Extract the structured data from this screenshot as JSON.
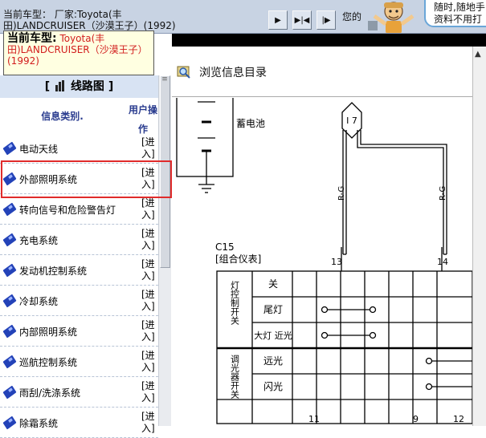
{
  "topbar": {
    "current_model_line": "当前车型：  厂家:Toyota(丰田)LANDCRUISER（沙漠王子）(1992)",
    "help_caption": "您的",
    "bubble_text": "随时,随地手 资料不用打"
  },
  "nav": {
    "forward": "▶",
    "skip": "▶|◀",
    "end": "|▶"
  },
  "model_box": {
    "label": "当前车型:",
    "value": "Toyota(丰田)LANDCRUISER（沙漠王子）(1992)"
  },
  "routes": {
    "title": "线路图",
    "bracket_left": "[",
    "bracket_right": "]",
    "col_category": "信息类别.",
    "col_user": "用户操作"
  },
  "items": [
    {
      "label": "电动天线",
      "action": "[进入]"
    },
    {
      "label": "外部照明系统",
      "action": "[进入]"
    },
    {
      "label": "转向信号和危险警告灯",
      "action": "[进入]"
    },
    {
      "label": "充电系统",
      "action": "[进入]"
    },
    {
      "label": "发动机控制系统",
      "action": "[进入]"
    },
    {
      "label": "冷却系统",
      "action": "[进入]"
    },
    {
      "label": "内部照明系统",
      "action": "[进入]"
    },
    {
      "label": "巡航控制系统",
      "action": "[进入]"
    },
    {
      "label": "雨刮/洗涤系统",
      "action": "[进入]"
    },
    {
      "label": "除霜系统",
      "action": "[进入]"
    }
  ],
  "viewer": {
    "title": "浏览信息目录"
  },
  "diagram": {
    "battery_label": "蓄电池",
    "connector_label": "I 7",
    "wire_label_left": "R-G",
    "wire_label_right": "R-G",
    "component_code": "C15",
    "component_name": "[组合仪表]",
    "pin_left": "13",
    "pin_right": "14",
    "switch_group_1": "灯控制开关",
    "switch_group_2": "调光器开关",
    "positions": [
      "关",
      "尾灯",
      "大灯 近光",
      "远光",
      "闪光"
    ],
    "bottom_pins": [
      "11",
      "9",
      "12"
    ]
  },
  "colors": {
    "highlight": "#e02b2b",
    "model_value": "#d21d1d",
    "header_bg": "#d8e3f3",
    "chip": "#2342b8"
  }
}
